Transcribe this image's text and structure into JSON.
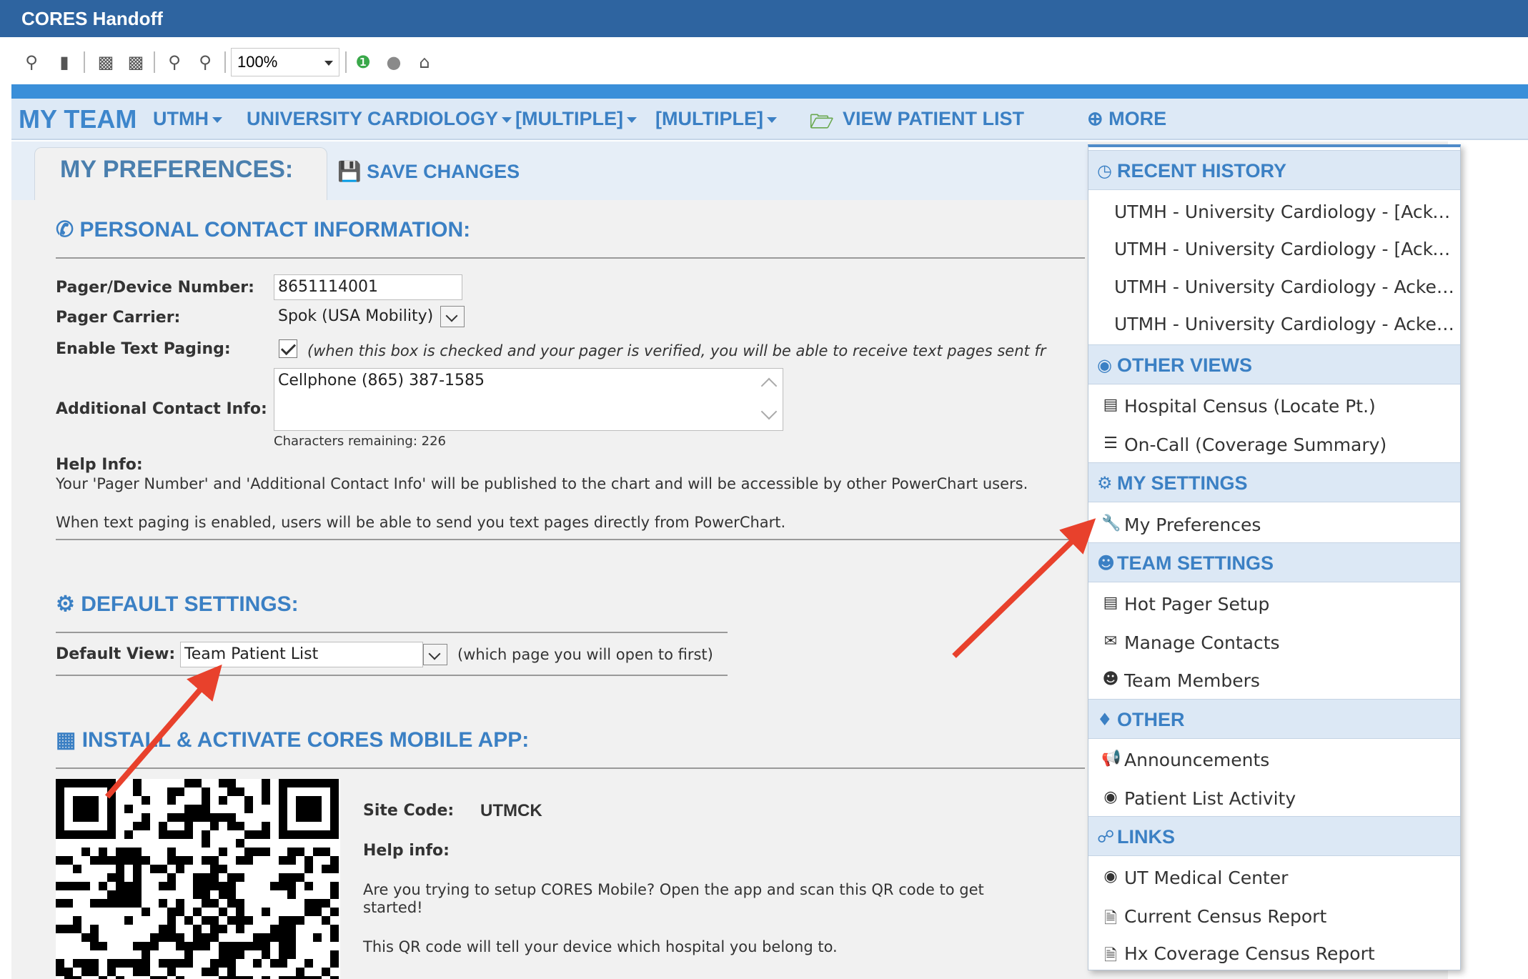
{
  "window": {
    "title": "CORES Handoff"
  },
  "toolbar": {
    "zoom": "100%"
  },
  "nav": {
    "my_team": "MY TEAM",
    "utmh": "UTMH",
    "university_cardiology": "UNIVERSITY CARDIOLOGY",
    "multiple_1": "[MULTIPLE]",
    "multiple_2": "[MULTIPLE]",
    "view_patient_list": "VIEW PATIENT LIST",
    "more": "MORE"
  },
  "preferences": {
    "title": "MY PREFERENCES:",
    "save_changes": "SAVE CHANGES",
    "personal": {
      "title": "PERSONAL CONTACT INFORMATION:",
      "pager_label": "Pager/Device Number:",
      "pager_value": "8651114001",
      "carrier_label": "Pager Carrier:",
      "carrier_value": "Spok (USA Mobility)",
      "text_paging_label": "Enable Text Paging:",
      "text_paging_note": "(when this box is checked and your pager is verified, you will be able to receive text pages sent fr",
      "contact_label": "Additional Contact Info:",
      "contact_value": "Cellphone (865) 387-1585",
      "chars_remaining": "Characters remaining: 226",
      "help_label": "Help Info:",
      "help_line1": "Your 'Pager Number' and 'Additional Contact Info' will be published to the chart and will be accessible by other PowerChart users.",
      "help_line2": "When text paging is enabled, users will be able to send you text pages directly from PowerChart."
    },
    "defaults": {
      "title": "DEFAULT SETTINGS:",
      "view_label": "Default View:",
      "view_value": "Team Patient List",
      "view_note": "(which page you will open to first)"
    },
    "mobile": {
      "title": "INSTALL & ACTIVATE CORES MOBILE APP:",
      "site_code_label": "Site Code:",
      "site_code_value": "UTMCK",
      "help_label": "Help info:",
      "help_line1": "Are you trying to setup CORES Mobile? Open the app and scan this QR code to get",
      "help_line1b": "started!",
      "help_line2": "This QR code will tell your device which hospital you belong to."
    }
  },
  "menu": {
    "recent_history": {
      "title": "RECENT HISTORY",
      "items": [
        "UTMH - University Cardiology - [Ackerman]",
        "UTMH - University Cardiology - [Ackerman]",
        "UTMH - University Cardiology - Ackerman",
        "UTMH - University Cardiology - Ackerman"
      ]
    },
    "other_views": {
      "title": "OTHER VIEWS",
      "items": [
        "Hospital Census (Locate Pt.)",
        "On-Call (Coverage Summary)"
      ]
    },
    "my_settings": {
      "title": "MY SETTINGS",
      "items": [
        "My Preferences"
      ]
    },
    "team_settings": {
      "title": "TEAM SETTINGS",
      "items": [
        "Hot Pager Setup",
        "Manage Contacts",
        "Team Members"
      ]
    },
    "other": {
      "title": "OTHER",
      "items": [
        "Announcements",
        "Patient List Activity"
      ]
    },
    "links": {
      "title": "LINKS",
      "items": [
        "UT Medical Center",
        "Current Census Report",
        "Hx Coverage Census Report"
      ]
    }
  },
  "colors": {
    "title_bar": "#2e64a0",
    "accent": "#3b80c4",
    "arrow": "#e8412c"
  }
}
